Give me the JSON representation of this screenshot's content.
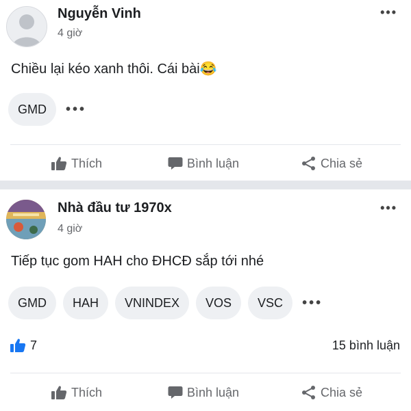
{
  "posts": [
    {
      "author": "Nguyễn Vinh",
      "time": "4 giờ",
      "text": "Chiều lại kéo xanh thôi. Cái bài",
      "emoji": "😂",
      "tags": [
        "GMD"
      ],
      "actions": {
        "like": "Thích",
        "comment": "Bình luận",
        "share": "Chia sẻ"
      }
    },
    {
      "author": "Nhà đầu tư 1970x",
      "time": "4 giờ",
      "text": "Tiếp tục gom HAH cho ĐHCĐ sắp tới nhé",
      "tags": [
        "GMD",
        "HAH",
        "VNINDEX",
        "VOS",
        "VSC"
      ],
      "likes": "7",
      "comments": "15 bình luận",
      "actions": {
        "like": "Thích",
        "comment": "Bình luận",
        "share": "Chia sẻ"
      }
    }
  ],
  "icons": {
    "more": "more-dots-icon",
    "like": "thumbs-up-icon",
    "comment": "comment-bubble-icon",
    "share": "share-icon"
  },
  "colors": {
    "accent": "#1877f2",
    "muted": "#65676b",
    "chip": "#eef0f3"
  }
}
